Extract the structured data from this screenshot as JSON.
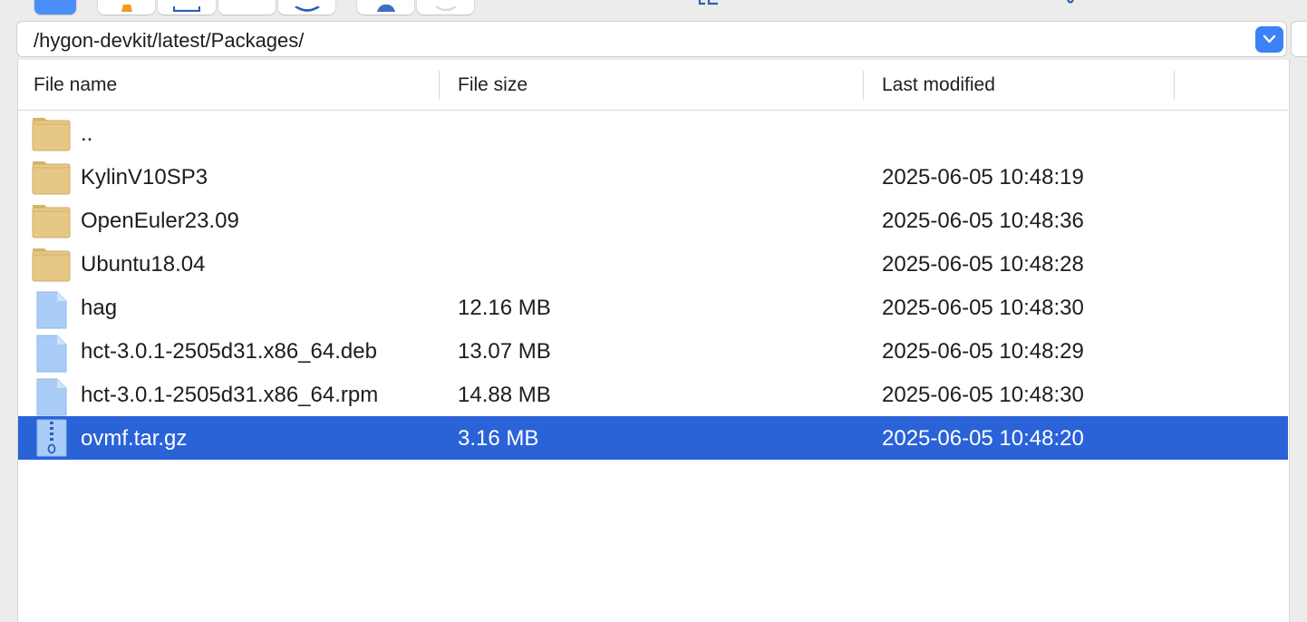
{
  "toolbar": {
    "buttons": [
      "primary-button",
      "alert-icon",
      "window-icon",
      "blank",
      "circle-icon",
      "person-icon",
      "disabled-circle-icon"
    ]
  },
  "pathbar": {
    "path": "/hygon-devkit/latest/Packages/",
    "dropdown_icon": "chevron-down-icon"
  },
  "table": {
    "columns": {
      "name": "File name",
      "size": "File size",
      "modified": "Last modified"
    },
    "rows": [
      {
        "name": "..",
        "size": "",
        "modified": "",
        "icon": "folder-icon"
      },
      {
        "name": "KylinV10SP3",
        "size": "",
        "modified": "2025-06-05 10:48:19",
        "icon": "folder-icon"
      },
      {
        "name": "OpenEuler23.09",
        "size": "",
        "modified": "2025-06-05 10:48:36",
        "icon": "folder-icon"
      },
      {
        "name": "Ubuntu18.04",
        "size": "",
        "modified": "2025-06-05 10:48:28",
        "icon": "folder-icon"
      },
      {
        "name": "hag",
        "size": "12.16 MB",
        "modified": "2025-06-05 10:48:30",
        "icon": "file-icon"
      },
      {
        "name": "hct-3.0.1-2505d31.x86_64.deb",
        "size": "13.07 MB",
        "modified": "2025-06-05 10:48:29",
        "icon": "file-icon"
      },
      {
        "name": "hct-3.0.1-2505d31.x86_64.rpm",
        "size": "14.88 MB",
        "modified": "2025-06-05 10:48:30",
        "icon": "file-icon"
      },
      {
        "name": "ovmf.tar.gz",
        "size": "3.16 MB",
        "modified": "2025-06-05 10:48:20",
        "icon": "archive-icon",
        "selected": true
      }
    ]
  },
  "colors": {
    "selection": "#2a62d8",
    "accent": "#3b82f6",
    "folder": "#e6c785",
    "file": "#a9cdf7"
  }
}
